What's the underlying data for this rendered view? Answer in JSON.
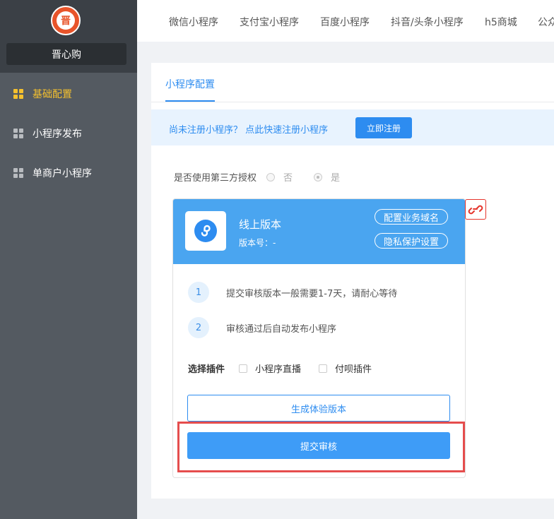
{
  "sidebar": {
    "logo_text": "晋",
    "store_name": "晋心购",
    "items": [
      {
        "label": "基础配置",
        "active": true
      },
      {
        "label": "小程序发布",
        "active": false
      },
      {
        "label": "单商户小程序",
        "active": false
      }
    ]
  },
  "topnav": {
    "tabs": [
      "微信小程序",
      "支付宝小程序",
      "百度小程序",
      "抖音/头条小程序",
      "h5商城",
      "公众"
    ]
  },
  "panel": {
    "subtab": "小程序配置",
    "notice": {
      "text": "尚未注册小程序？ 点此快速注册小程序",
      "button": "立即注册"
    },
    "auth": {
      "label": "是否使用第三方授权",
      "options": [
        "否",
        "是"
      ],
      "selected": "是"
    },
    "card": {
      "title": "线上版本",
      "version_label": "版本号：-",
      "config_domain_button": "配置业务域名",
      "privacy_button": "隐私保护设置",
      "steps": [
        {
          "num": "1",
          "text": "提交审核版本一般需要1-7天，请耐心等待"
        },
        {
          "num": "2",
          "text": "审核通过后自动发布小程序"
        }
      ],
      "plugins_label": "选择插件",
      "plugins": [
        "小程序直播",
        "付呗插件"
      ],
      "generate_button": "生成体验版本",
      "submit_button": "提交审核"
    }
  },
  "colors": {
    "accent": "#2d8cf0",
    "sidebar_bg": "#545a61",
    "active_menu": "#f5c12e",
    "highlight": "#e54d4d"
  }
}
